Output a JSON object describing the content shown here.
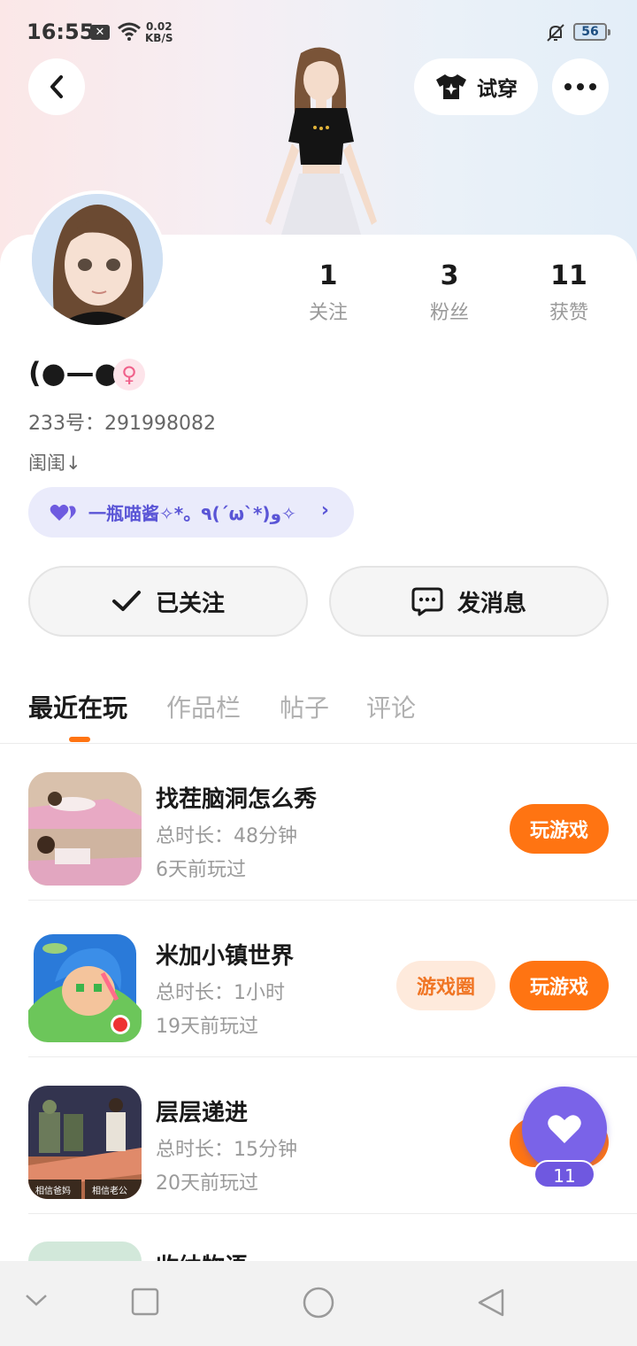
{
  "status_bar": {
    "time": "16:55",
    "network_speed_value": "0.02",
    "network_speed_unit": "KB/S",
    "battery": "56"
  },
  "header": {
    "try_on_label": "试穿"
  },
  "profile": {
    "name": "(●—●)",
    "gender_symbol": "♀",
    "uid": "233号：291998082",
    "bio": "闺闺↓",
    "stats": [
      {
        "value": "1",
        "label": "关注"
      },
      {
        "value": "3",
        "label": "粉丝"
      },
      {
        "value": "11",
        "label": "获赞"
      }
    ],
    "relation_pill": "一瓶喵酱✧*。٩(ˊωˋ*)و✧"
  },
  "actions": {
    "follow_label": "已关注",
    "message_label": "发消息"
  },
  "tabs": [
    "最近在玩",
    "作品栏",
    "帖子",
    "评论"
  ],
  "games": [
    {
      "title": "找茬脑洞怎么秀",
      "duration": "总时长：48分钟",
      "last_played": "6天前玩过",
      "play_label": "玩游戏"
    },
    {
      "title": "米加小镇世界",
      "duration": "总时长：1小时",
      "last_played": "19天前玩过",
      "circle_label": "游戏圈",
      "play_label": "玩游戏"
    },
    {
      "title": "层层递进",
      "duration": "总时长：15分钟",
      "last_played": "20天前玩过",
      "icon_label_left": "相信爸妈",
      "icon_label_right": "相信老公"
    }
  ],
  "peek_game_title": "收纳物语",
  "like_button": {
    "count": "11"
  },
  "colors": {
    "accent": "#ff7412",
    "purple": "#7a63e8",
    "pill_bg": "#eaebfb"
  }
}
